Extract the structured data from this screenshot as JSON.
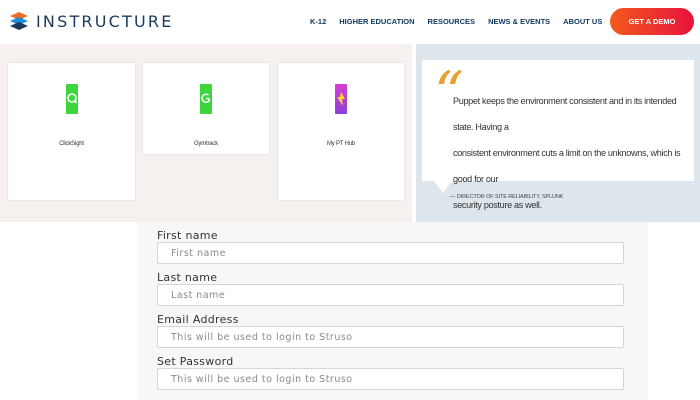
{
  "header": {
    "logo_text": "INSTRUCTURE",
    "nav": [
      "K-12",
      "HIGHER EDUCATION",
      "RESOURCES",
      "NEWS & EVENTS",
      "ABOUT US"
    ],
    "cta_label": "GET A DEMO"
  },
  "tiles": [
    {
      "label": "ClickSight",
      "icon": "green-app-icon"
    },
    {
      "label": "Gymtrack",
      "icon": "green-app-icon"
    },
    {
      "label": "My PT Hub",
      "icon": "purple-app-icon"
    }
  ],
  "testimonial": {
    "quote_line_1": "Puppet keeps the environment consistent and in its intended state. Having a",
    "quote_line_2": "consistent environment cuts a limit on the unknowns, which is good for our",
    "quote_line_3": "security posture as well.",
    "author": "— DIRECTOR OF SITE RELIABILITY, SPLUNK"
  },
  "form": {
    "first_name_label": "First name",
    "first_name_placeholder": "First name",
    "last_name_label": "Last name",
    "last_name_placeholder": "Last name",
    "email_label": "Email Address",
    "email_placeholder": "This will be used to login to Struso",
    "password_label": "Set Password",
    "password_placeholder": "This will be used to login to Struso"
  },
  "colors": {
    "brand_navy": "#1b3a5c",
    "cta_start": "#f25a1e",
    "cta_end": "#e8123c",
    "quote_accent": "#e8a12c",
    "tile_green": "#3cd63c",
    "tile_purple": "#8a3fd8"
  }
}
